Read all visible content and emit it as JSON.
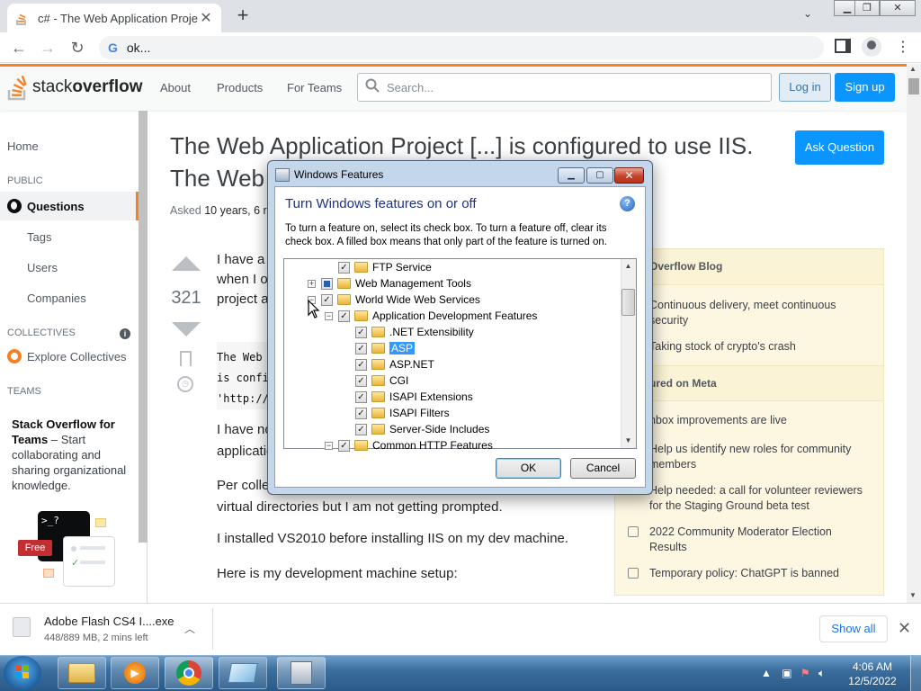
{
  "browser": {
    "tab_title": "c# - The Web Application Project [...] is configured to use IIS",
    "address": "ok..."
  },
  "so": {
    "logo_light": "stack",
    "logo_bold": "overflow",
    "nav": [
      "About",
      "Products",
      "For Teams"
    ],
    "search_placeholder": "Search...",
    "login": "Log in",
    "signup": "Sign up",
    "left_nav": {
      "home": "Home",
      "public": "PUBLIC",
      "questions": "Questions",
      "tags": "Tags",
      "users": "Users",
      "companies": "Companies",
      "collectives": "COLLECTIVES",
      "explore": "Explore Collectives",
      "teams": "TEAMS",
      "teams_title": "Stack Overflow for Teams",
      "teams_text": " – Start collaborating and sharing organizational knowledge.",
      "free_badge": "Free"
    },
    "question": {
      "title_line1": "The Web Application Project [...] is configured to use IIS.",
      "title_line2": "The Web",
      "asked_label": "Asked",
      "asked_value": "10 years, 6 r",
      "votes": "321",
      "ask_button": "Ask Question",
      "p1_l1": "I have a",
      "p1_l2": "when I o",
      "p1_l3": "project a",
      "code_l1": "The Web",
      "code_l2": "is confi",
      "code_l3": "'http://",
      "p2_l1": "I have no",
      "p2_l2": "applicatio",
      "p3_l1": "Per colle",
      "p3_l2": "virtual directories but I am not getting prompted.",
      "p4": "I installed VS2010 before installing IIS on my dev machine.",
      "p5": "Here is my development machine setup:"
    },
    "sidebar": {
      "blog_header": "Overflow Blog",
      "blog_items": [
        "Continuous delivery, meet continuous security",
        "Taking stock of crypto's crash"
      ],
      "meta_header": "ured on Meta",
      "meta_items": [
        "nbox improvements are live",
        "Help us identify new roles for community members",
        "Help needed: a call for volunteer reviewers for the Staging Ground beta test",
        "2022 Community Moderator Election Results",
        "Temporary policy: ChatGPT is banned"
      ]
    }
  },
  "dialog": {
    "title": "Windows Features",
    "heading": "Turn Windows features on or off",
    "description": "To turn a feature on, select its check box. To turn a feature off, clear its check box. A filled box means that only part of the feature is turned on.",
    "tree": [
      {
        "label": "FTP Service",
        "state": "checked",
        "level": 2,
        "expander": ""
      },
      {
        "label": "Web Management Tools",
        "state": "partial",
        "level": 1,
        "expander": "+"
      },
      {
        "label": "World Wide Web Services",
        "state": "checked",
        "level": 1,
        "expander": "−"
      },
      {
        "label": "Application Development Features",
        "state": "checked",
        "level": 2,
        "expander": "−"
      },
      {
        "label": ".NET Extensibility",
        "state": "checked",
        "level": 3,
        "expander": ""
      },
      {
        "label": "ASP",
        "state": "checked",
        "level": 3,
        "expander": "",
        "selected": true
      },
      {
        "label": "ASP.NET",
        "state": "checked",
        "level": 3,
        "expander": ""
      },
      {
        "label": "CGI",
        "state": "checked",
        "level": 3,
        "expander": ""
      },
      {
        "label": "ISAPI Extensions",
        "state": "checked",
        "level": 3,
        "expander": ""
      },
      {
        "label": "ISAPI Filters",
        "state": "checked",
        "level": 3,
        "expander": ""
      },
      {
        "label": "Server-Side Includes",
        "state": "checked",
        "level": 3,
        "expander": ""
      },
      {
        "label": "Common HTTP Features",
        "state": "checked",
        "level": 2,
        "expander": "−"
      }
    ],
    "ok": "OK",
    "cancel": "Cancel"
  },
  "download": {
    "name": "Adobe Flash CS4 I....exe",
    "status": "448/889 MB, 2 mins left",
    "show_all": "Show all"
  },
  "taskbar": {
    "time": "4:06 AM",
    "date": "12/5/2022"
  },
  "colors": {
    "so_orange": "#f48225",
    "so_blue": "#0a95ff",
    "selection": "#3399ff",
    "dialog_heading": "#1e3287"
  },
  "icons": [
    "so-logo-icon",
    "search-icon",
    "back-icon",
    "forward-icon",
    "reload-icon",
    "google-icon",
    "globe-icon",
    "collectives-icon",
    "info-icon",
    "bookmark-icon",
    "history-icon",
    "help-icon",
    "folder-icon",
    "file-icon",
    "close-icon",
    "chevron-up-icon",
    "start-orb-icon",
    "explorer-icon",
    "media-player-icon",
    "chrome-icon",
    "control-panel-icon",
    "windows-features-icon"
  ]
}
